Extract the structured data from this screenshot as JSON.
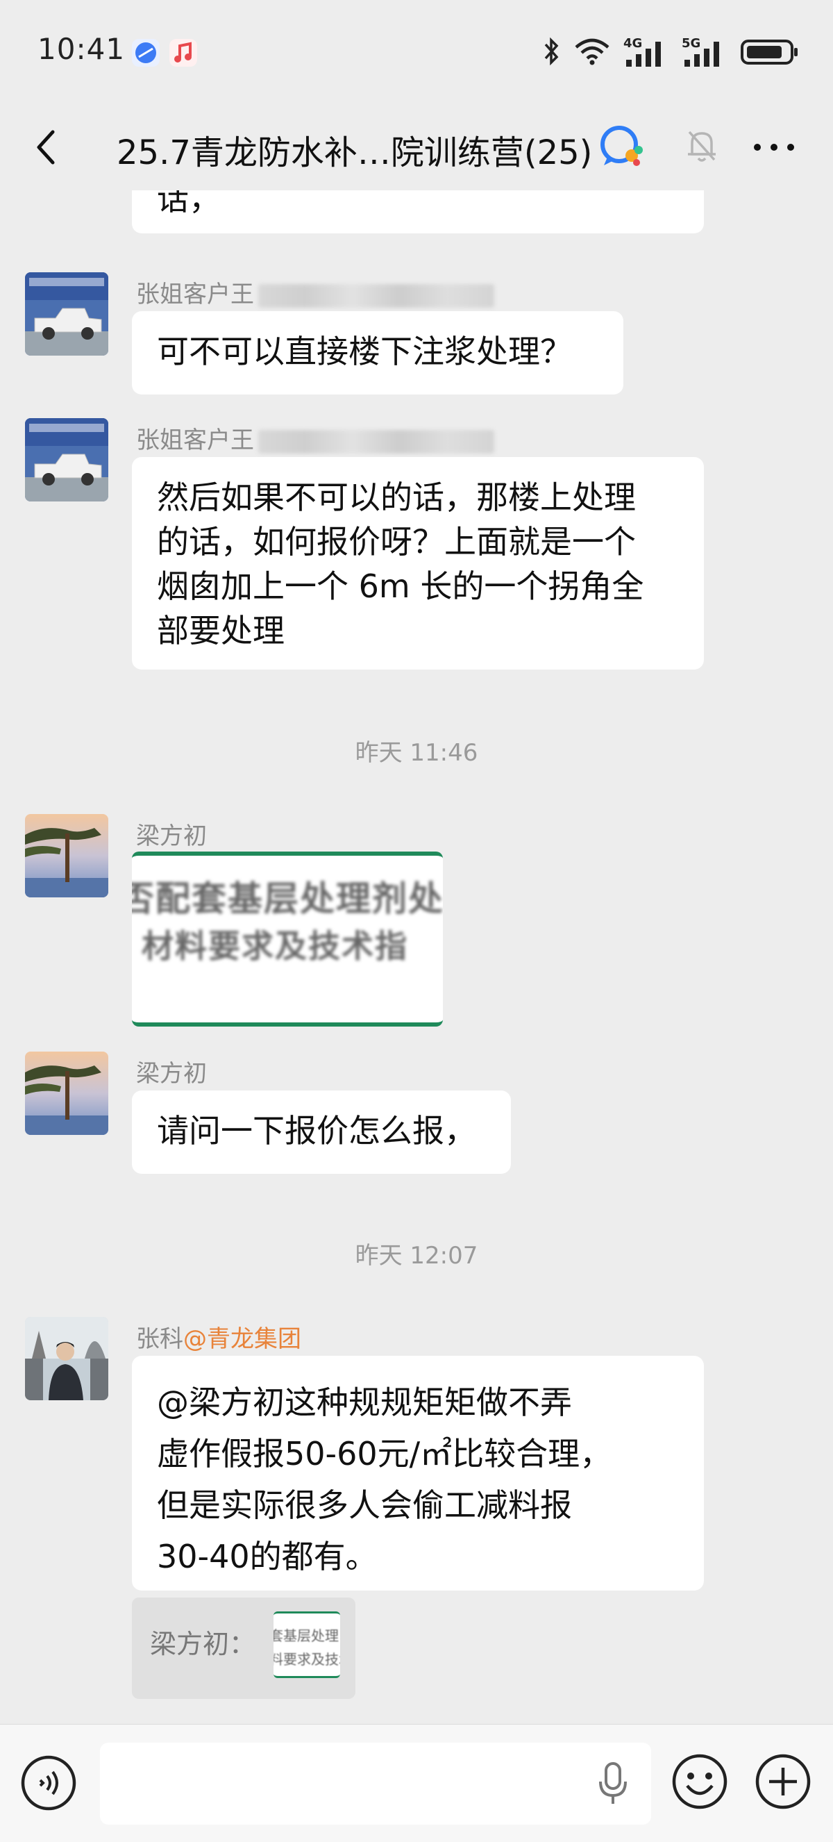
{
  "status_bar": {
    "time": "10:41",
    "network_1": "4G",
    "network_2": "5G",
    "icons": [
      "browser-app-icon",
      "music-app-icon",
      "bluetooth-icon",
      "wifi-icon",
      "signal-icon",
      "battery-icon"
    ]
  },
  "header": {
    "title": "25.7青龙防水补…院训练营(25)",
    "icons": [
      "back-icon",
      "ai-assistant-icon",
      "mute-bell-icon",
      "more-icon"
    ]
  },
  "messages": [
    {
      "type": "text-partial",
      "text": "话，"
    },
    {
      "type": "text",
      "sender": "张姐客户王",
      "avatar": "truck-photo",
      "text": "可不可以直接楼下注浆处理？"
    },
    {
      "type": "text",
      "sender": "张姐客户王",
      "avatar": "truck-photo",
      "lines": [
        "然后如果不可以的话，那楼上处理",
        "的话，如何报价呀？上面就是一个",
        "烟囱加上一个 6m 长的一个拐角全",
        "部要处理"
      ]
    },
    {
      "type": "time",
      "text": "昨天 11:46"
    },
    {
      "type": "image",
      "sender": "梁方初",
      "avatar": "pine-tree-photo",
      "image_lines": [
        "否配套基层处理剂处",
        "材料要求及技术指"
      ]
    },
    {
      "type": "text",
      "sender": "梁方初",
      "avatar": "pine-tree-photo",
      "text": "请问一下报价怎么报，"
    },
    {
      "type": "time",
      "text": "昨天 12:07"
    },
    {
      "type": "text",
      "sender": "张科",
      "sender_tag": "@青龙集团",
      "avatar": "person-photo",
      "lines": [
        "@梁方初这种规规矩矩做不弄",
        "虚作假报50-60元/㎡比较合理，",
        "但是实际很多人会偷工减料报",
        "30-40的都有。"
      ]
    },
    {
      "type": "quote",
      "label": "梁方初：",
      "thumb_lines": [
        "套基层处理",
        "料要求及技术"
      ]
    }
  ],
  "input_bar": {
    "placeholder": "",
    "icons": [
      "voice-icon",
      "mic-icon",
      "emoji-icon",
      "plus-icon"
    ]
  },
  "colors": {
    "background": "#ededed",
    "bubble": "#ffffff",
    "mention": "#e8833a",
    "green_border": "#1f8a5a"
  }
}
